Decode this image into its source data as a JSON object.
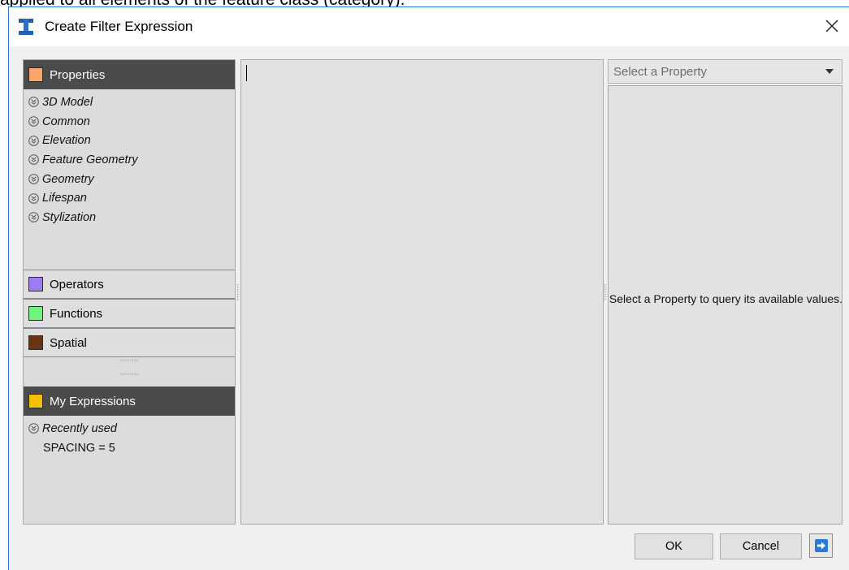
{
  "background_caption": "applied to all elements of the feature class (category).",
  "dialog": {
    "title": "Create Filter Expression"
  },
  "left_panel": {
    "properties": {
      "header": "Properties",
      "color": "#f9a66c",
      "items": [
        {
          "label": "3D Model"
        },
        {
          "label": "Common"
        },
        {
          "label": "Elevation"
        },
        {
          "label": "Feature Geometry"
        },
        {
          "label": "Geometry"
        },
        {
          "label": "Lifespan"
        },
        {
          "label": "Stylization"
        }
      ]
    },
    "operators": {
      "header": "Operators",
      "color": "#9e7df2"
    },
    "functions": {
      "header": "Functions",
      "color": "#72f47c"
    },
    "spatial": {
      "header": "Spatial",
      "color": "#6a3410"
    },
    "my_expressions": {
      "header": "My Expressions",
      "color": "#f2c200",
      "group_label": "Recently used",
      "items": [
        {
          "label": "SPACING = 5"
        }
      ]
    }
  },
  "editor": {
    "value": ""
  },
  "right_panel": {
    "select_placeholder": "Select a Property",
    "message": "Select a Property to query its available values."
  },
  "buttons": {
    "ok": "OK",
    "cancel": "Cancel"
  }
}
